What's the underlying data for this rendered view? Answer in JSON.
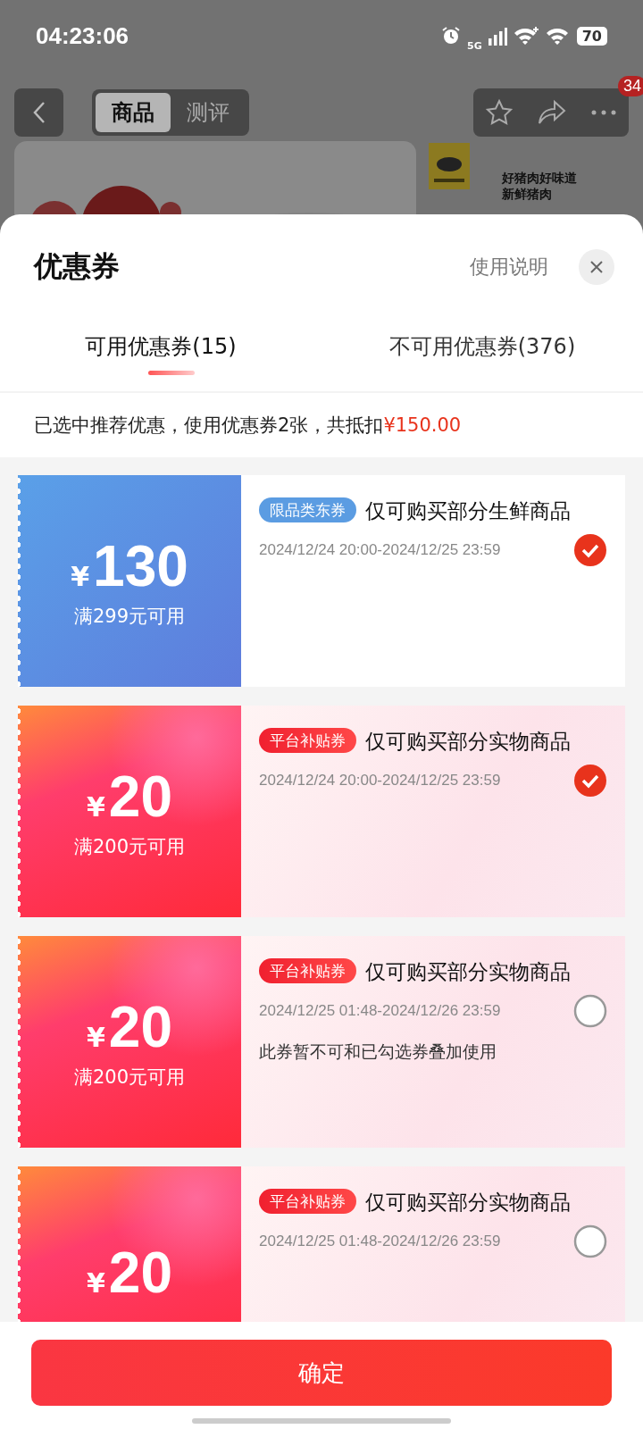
{
  "status_bar": {
    "time": "04:23:06",
    "network": "5G",
    "battery": "70"
  },
  "nav": {
    "tabs": [
      {
        "label": "商品",
        "selected": true
      },
      {
        "label": "测评",
        "selected": false
      }
    ],
    "badge": "34"
  },
  "product": {
    "slogan": [
      "好猪肉好味道",
      "新鲜猪肉"
    ]
  },
  "sheet": {
    "title": "优惠券",
    "help": "使用说明",
    "tabs": [
      {
        "label": "可用优惠券(15)",
        "selected": true
      },
      {
        "label": "不可用优惠券(376)",
        "selected": false
      }
    ],
    "summary": {
      "text": "已选中推荐优惠，使用优惠券2张，共抵扣",
      "amount": "¥150.00"
    },
    "coupons": [
      {
        "kind": "category",
        "currency": "¥",
        "amount": "130",
        "condition": "满299元可用",
        "tag": "限品类东券",
        "title": "仅可购买部分生鲜商品",
        "validity": "2024/12/24 20:00-2024/12/25 23:59",
        "selected": true
      },
      {
        "kind": "platform",
        "currency": "¥",
        "amount": "20",
        "condition": "满200元可用",
        "tag": "平台补贴券",
        "title": "仅可购买部分实物商品",
        "validity": "2024/12/24 20:00-2024/12/25 23:59",
        "selected": true
      },
      {
        "kind": "platform",
        "currency": "¥",
        "amount": "20",
        "condition": "满200元可用",
        "tag": "平台补贴券",
        "title": "仅可购买部分实物商品",
        "validity": "2024/12/25 01:48-2024/12/26 23:59",
        "note": "此券暂不可和已勾选券叠加使用",
        "selected": false
      },
      {
        "kind": "platform",
        "currency": "¥",
        "amount": "20",
        "tag": "平台补贴券",
        "title": "仅可购买部分实物商品",
        "validity": "2024/12/25 01:48-2024/12/26 23:59",
        "selected": false
      }
    ],
    "confirm": "确定"
  }
}
